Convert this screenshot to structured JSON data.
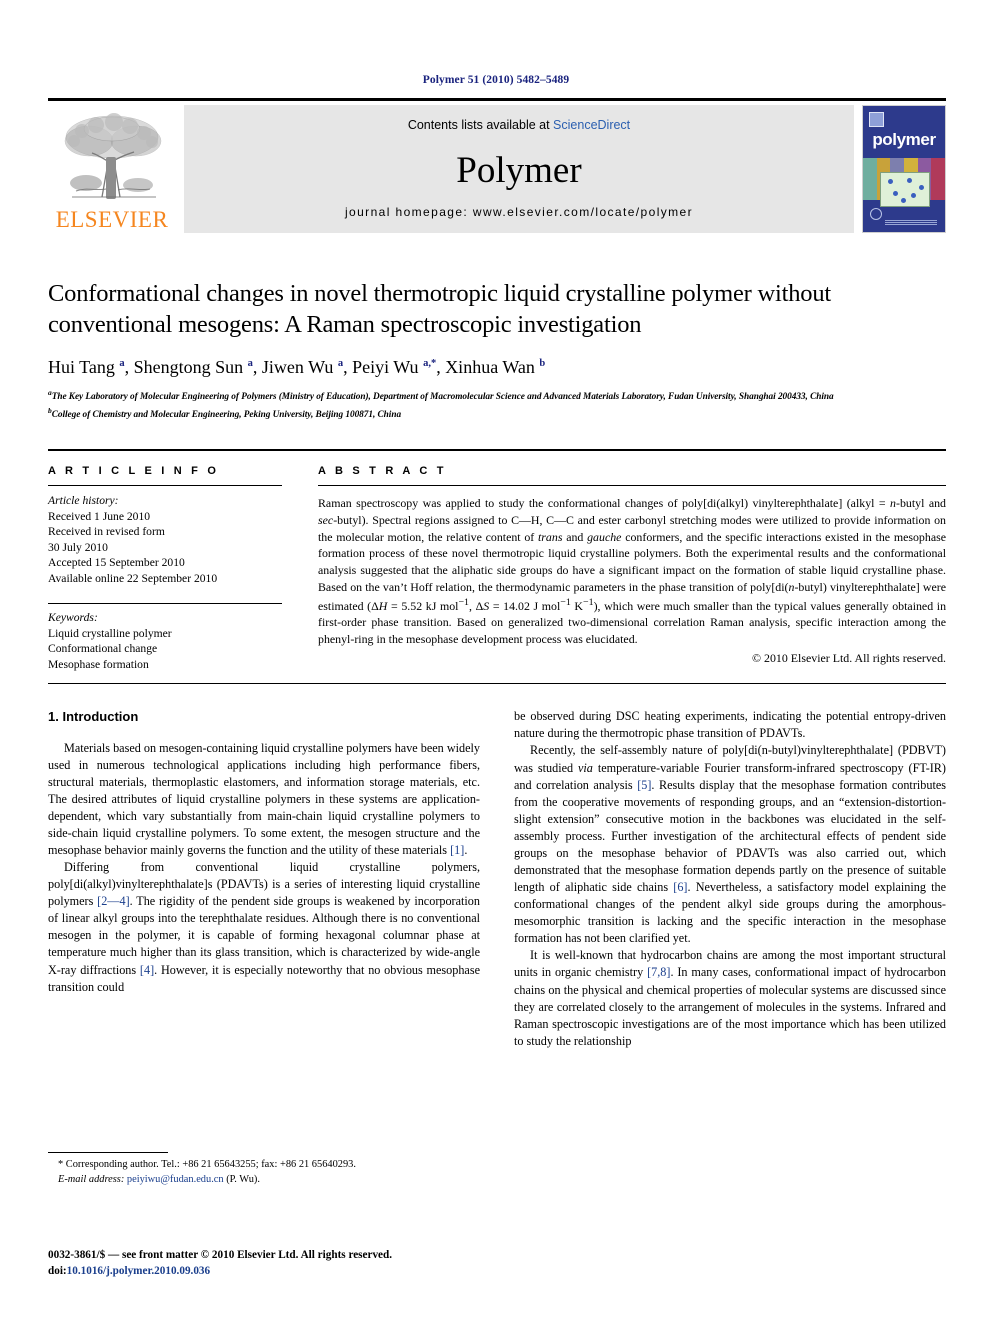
{
  "running_head": "Polymer 51 (2010) 5482–5489",
  "masthead": {
    "publisher_name": "ELSEVIER",
    "contents_prefix": "Contents lists available at ",
    "contents_link": "ScienceDirect",
    "journal_title": "Polymer",
    "homepage_line": "journal homepage: www.elsevier.com/locate/polymer",
    "cover_title": "polymer"
  },
  "article": {
    "title": "Conformational changes in novel thermotropic liquid crystalline polymer without conventional mesogens: A Raman spectroscopic investigation",
    "authors_html": "Hui Tang <sup>a</sup>, Shengtong Sun <sup>a</sup>, Jiwen Wu <sup>a</sup>, Peiyi Wu <sup>a,*</sup>, Xinhua Wan <sup>b</sup>",
    "affiliation_a": "The Key Laboratory of Molecular Engineering of Polymers (Ministry of Education), Department of Macromolecular Science and Advanced Materials Laboratory, Fudan University, Shanghai 200433, China",
    "affiliation_b": "College of Chemistry and Molecular Engineering, Peking University, Beijing 100871, China"
  },
  "info": {
    "heading": "A R T I C L E   I N F O",
    "history_label": "Article history:",
    "history": [
      "Received 1 June 2010",
      "Received in revised form",
      "30 July 2010",
      "Accepted 15 September 2010",
      "Available online 22 September 2010"
    ],
    "keywords_label": "Keywords:",
    "keywords": [
      "Liquid crystalline polymer",
      "Conformational change",
      "Mesophase formation"
    ]
  },
  "abstract": {
    "heading": "A B S T R A C T",
    "text_html": "Raman spectroscopy was applied to study the conformational changes of poly[di(alkyl) vinylterephthalate] (alkyl = <i>n</i>-butyl and <i>sec</i>-butyl). Spectral regions assigned to C&#8212;H, C&#8212;C and ester carbonyl stretching modes were utilized to provide information on the molecular motion, the relative content of <i>trans</i> and <i>gauche</i> conformers, and the specific interactions existed in the mesophase formation process of these novel thermotropic liquid crystalline polymers. Both the experimental results and the conformational analysis suggested that the aliphatic side groups do have a significant impact on the formation of stable liquid crystalline phase. Based on the van&#8217;t Hoff relation, the thermodynamic parameters in the phase transition of poly[di(<i>n</i>-butyl) vinylterephthalate] were estimated (&#916;<i>H</i> = 5.52 kJ mol<sup>&#8722;1</sup>, &#916;<i>S</i> = 14.02 J mol<sup>&#8722;1</sup> K<sup>&#8722;1</sup>), which were much smaller than the typical values generally obtained in first-order phase transition. Based on generalized two-dimensional correlation Raman analysis, specific interaction among the phenyl-ring in the mesophase development process was elucidated.",
    "copyright": "© 2010 Elsevier Ltd. All rights reserved."
  },
  "body": {
    "section_heading": "1. Introduction",
    "left_paragraphs_html": [
      "Materials based on mesogen-containing liquid crystalline polymers have been widely used in numerous technological applications including high performance fibers, structural materials, thermoplastic elastomers, and information storage materials, etc. The desired attributes of liquid crystalline polymers in these systems are application-dependent, which vary substantially from main-chain liquid crystalline polymers to side-chain liquid crystalline polymers. To some extent, the mesogen structure and the mesophase behavior mainly governs the function and the utility of these materials <span class=\"ref\">[1]</span>.",
      "Differing from conventional liquid crystalline polymers, poly[di(alkyl)vinylterephthalate]s (PDAVTs) is a series of interesting liquid crystalline polymers <span class=\"ref\">[2&#8212;4]</span>. The rigidity of the pendent side groups is weakened by incorporation of linear alkyl groups into the terephthalate residues. Although there is no conventional mesogen in the polymer, it is capable of forming hexagonal columnar phase at temperature much higher than its glass transition, which is characterized by wide-angle X-ray diffractions <span class=\"ref\">[4]</span>. However, it is especially noteworthy that no obvious mesophase transition could"
    ],
    "right_paragraphs_html": [
      "be observed during DSC heating experiments, indicating the potential entropy-driven nature during the thermotropic phase transition of PDAVTs.",
      "Recently, the self-assembly nature of poly[di(n-butyl)vinylterephthalate] (PDBVT) was studied <i>via</i> temperature-variable Fourier transform-infrared spectroscopy (FT-IR) and correlation analysis <span class=\"ref\">[5]</span>. Results display that the mesophase formation contributes from the cooperative movements of responding groups, and an &#8220;extension-distortion-slight extension&#8221; consecutive motion in the backbones was elucidated in the self-assembly process. Further investigation of the architectural effects of pendent side groups on the mesophase behavior of PDAVTs was also carried out, which demonstrated that the mesophase formation depends partly on the presence of suitable length of aliphatic side chains <span class=\"ref\">[6]</span>. Nevertheless, a satisfactory model explaining the conformational changes of the pendent alkyl side groups during the amorphous-mesomorphic transition is lacking and the specific interaction in the mesophase formation has not been clarified yet.",
      "It is well-known that hydrocarbon chains are among the most important structural units in organic chemistry <span class=\"ref\">[7,8]</span>. In many cases, conformational impact of hydrocarbon chains on the physical and chemical properties of molecular systems are discussed since they are correlated closely to the arrangement of molecules in the systems. Infrared and Raman spectroscopic investigations are of the most importance which has been utilized to study the relationship"
    ]
  },
  "footnotes": {
    "corresponding_html": "* Corresponding author. Tel.: +86 21 65643255; fax: +86 21 65640293.",
    "email_label": "E-mail address:",
    "email": "peiyiwu@fudan.edu.cn",
    "email_suffix": "(P. Wu).",
    "issn_line_html": "0032-3861/$ &#8212; see front matter &#169; 2010 Elsevier Ltd. All rights reserved.",
    "doi_label": "doi:",
    "doi": "10.1016/j.polymer.2010.09.036"
  },
  "colors": {
    "link_blue": "#1a3e8c",
    "sciencedirect_blue": "#2b5fb0",
    "elsevier_orange": "#f5861f",
    "band_gray": "#e6e6e6",
    "cover_blue": "#2d3a8c"
  }
}
